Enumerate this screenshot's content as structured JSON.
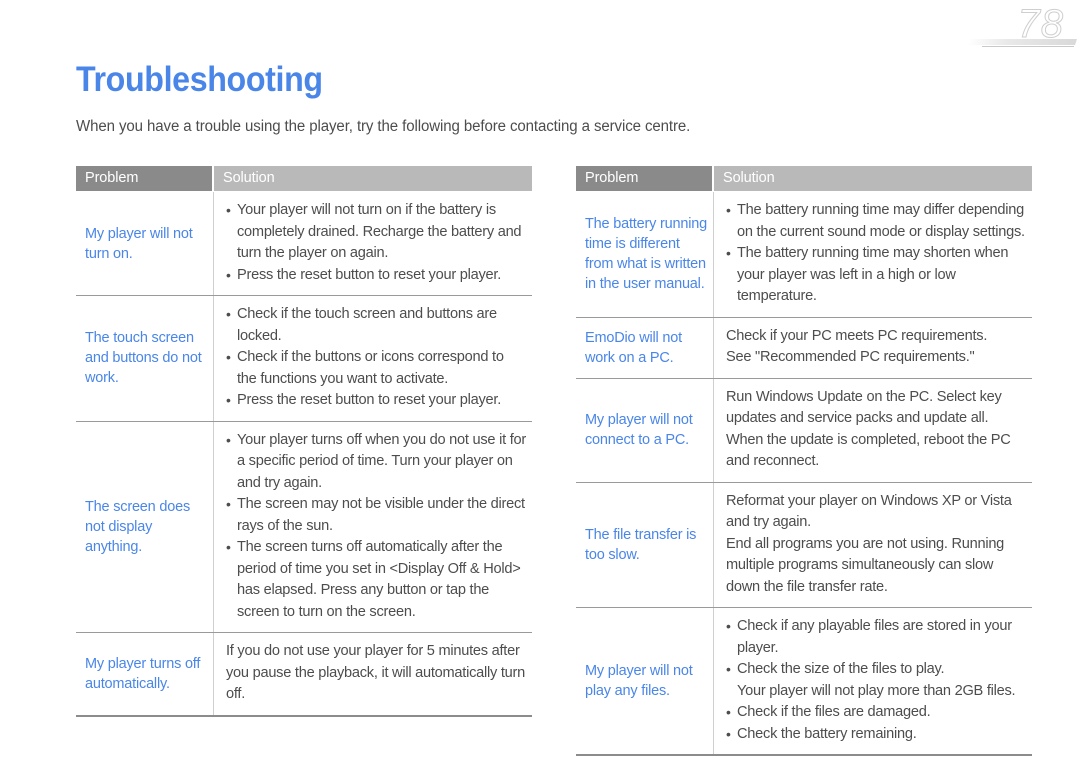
{
  "page": {
    "number": "78",
    "title": "Troubleshooting",
    "intro": "When you have a trouble using the player, try the following before contacting a service centre.",
    "accent_blue": "#4a86e8",
    "header_problem_bg": "#8a8a8a",
    "header_solution_bg": "#b9b9b9",
    "body_text_color": "#4d4d4d"
  },
  "table_headers": {
    "problem": "Problem",
    "solution": "Solution"
  },
  "left_table": {
    "rows": [
      {
        "problem": "My player will not turn on.",
        "solutions": [
          {
            "bullet": true,
            "text": "Your player will not turn on if the battery is completely drained. Recharge the battery and turn the player on again."
          },
          {
            "bullet": true,
            "text": "Press the reset button to reset your player."
          }
        ]
      },
      {
        "problem": "The touch screen and buttons do not work.",
        "solutions": [
          {
            "bullet": true,
            "text": "Check if the touch screen and buttons are locked."
          },
          {
            "bullet": true,
            "text": "Check if the buttons or icons correspond to the functions you want to activate."
          },
          {
            "bullet": true,
            "text": "Press the reset button to reset your player."
          }
        ]
      },
      {
        "problem": "The screen does not display anything.",
        "solutions": [
          {
            "bullet": true,
            "text": "Your player turns off when you do not use it for a specific period of time. Turn your player on and try again."
          },
          {
            "bullet": true,
            "text": "The screen may not be visible under the direct rays of the sun."
          },
          {
            "bullet": true,
            "text": "The screen turns off automatically after the period of time you set in <Display Off & Hold> has elapsed. Press any button or tap the screen to turn on the screen."
          }
        ]
      },
      {
        "problem": "My player turns off automatically.",
        "solutions": [
          {
            "bullet": false,
            "text": "If you do not use your player for 5 minutes after you pause the playback, it will automatically turn off."
          }
        ]
      }
    ]
  },
  "right_table": {
    "rows": [
      {
        "problem": "The battery running time is different from what is written in the user manual.",
        "solutions": [
          {
            "bullet": true,
            "text": "The battery running time may differ depending on the current sound mode or display settings."
          },
          {
            "bullet": true,
            "text": "The battery running time may shorten when your player was left in a high or low temperature."
          }
        ]
      },
      {
        "problem": "EmoDio will not work on a PC.",
        "solutions": [
          {
            "bullet": false,
            "text": "Check if your PC meets PC requirements."
          },
          {
            "bullet": false,
            "text": "See \"Recommended PC requirements.\""
          }
        ]
      },
      {
        "problem": "My player will not connect to a PC.",
        "solutions": [
          {
            "bullet": false,
            "text": "Run Windows Update on the PC. Select key updates and service packs and update all. When the update is completed, reboot the PC and reconnect."
          }
        ]
      },
      {
        "problem": "The file transfer is too slow.",
        "solutions": [
          {
            "bullet": false,
            "text": "Reformat your player on Windows XP or Vista and try again."
          },
          {
            "bullet": false,
            "text": "End all programs you are not using. Running multiple programs simultaneously can slow down the file transfer rate."
          }
        ]
      },
      {
        "problem": "My player will not play any files.",
        "solutions": [
          {
            "bullet": true,
            "text": "Check if any playable files are stored in your player."
          },
          {
            "bullet": true,
            "text": "Check the size of the files to play."
          },
          {
            "bullet": false,
            "sub": true,
            "text": "Your player will not play more than 2GB files."
          },
          {
            "bullet": true,
            "text": "Check if the files are damaged."
          },
          {
            "bullet": true,
            "text": "Check the battery remaining."
          }
        ]
      }
    ]
  }
}
